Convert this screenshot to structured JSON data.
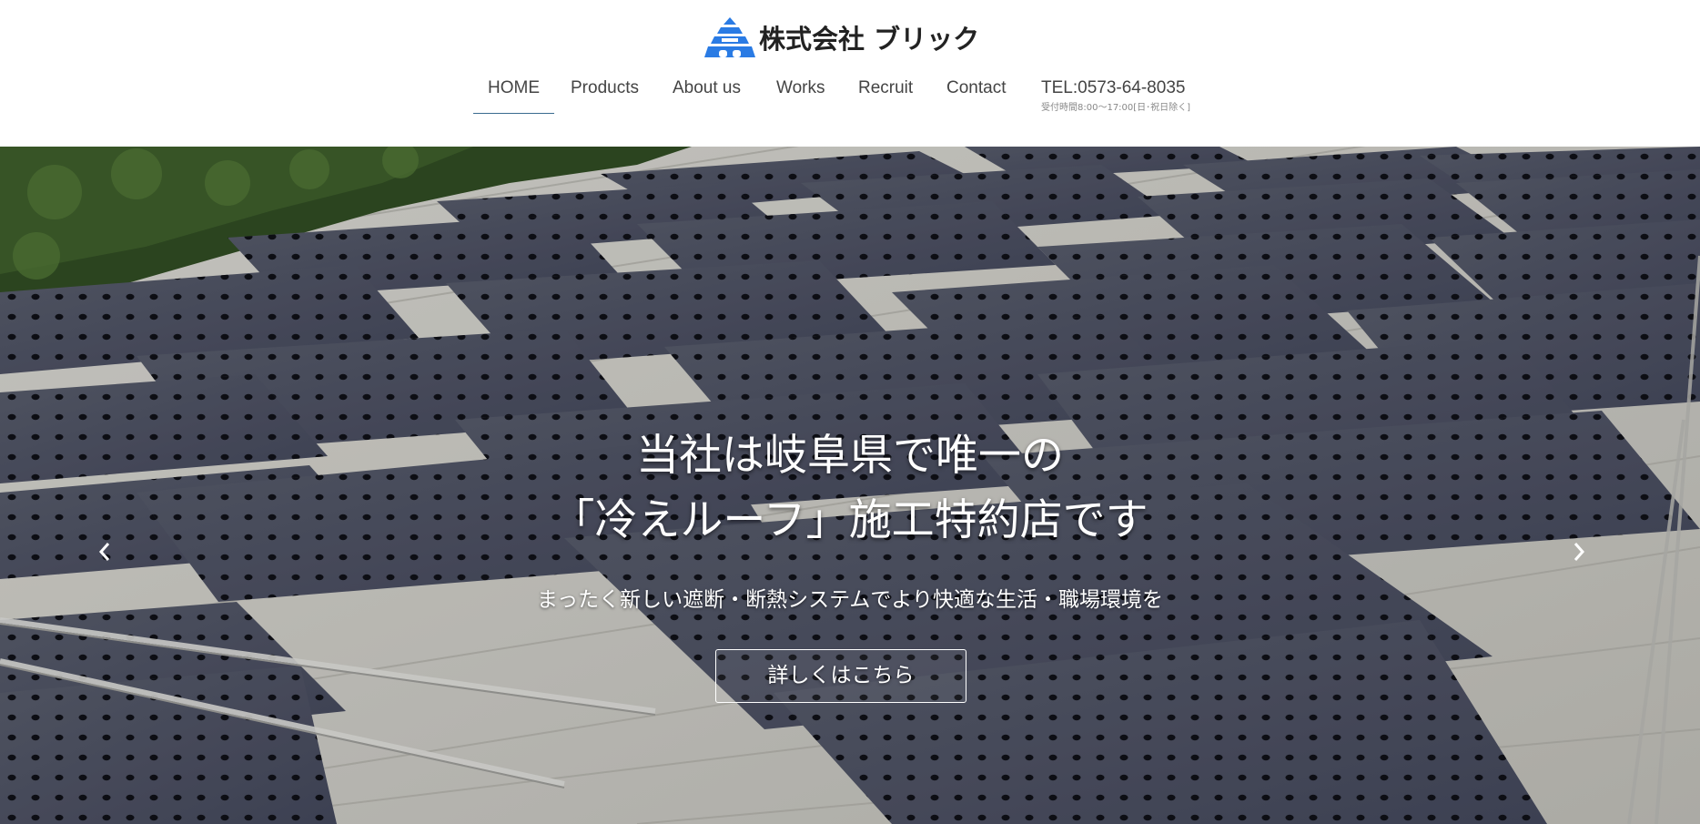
{
  "header": {
    "logo_text": "株式会社 ブリック",
    "nav": {
      "home": "HOME",
      "products": "Products",
      "about": "About us",
      "works": "Works",
      "recruit": "Recruit",
      "contact": "Contact"
    },
    "tel": {
      "number": "TEL:0573-64-8035",
      "hours": "受付時間8:00〜17:00[日･祝日除く]"
    }
  },
  "hero": {
    "title_line1": "当社は岐阜県で唯一の",
    "title_line2": "「冷えルーフ」施工特約店です",
    "subtitle": "まったく新しい遮断・断熱システムでより快適な生活・職場環境を",
    "button_label": "詳しくはこちら",
    "prev_icon": "chevron-left-icon",
    "next_icon": "chevron-right-icon"
  },
  "colors": {
    "logo_blue": "#2a7be4",
    "nav_active_underline": "#3a6b8f",
    "panel": "#4a4e5c",
    "roof": "#c9c8c2"
  }
}
